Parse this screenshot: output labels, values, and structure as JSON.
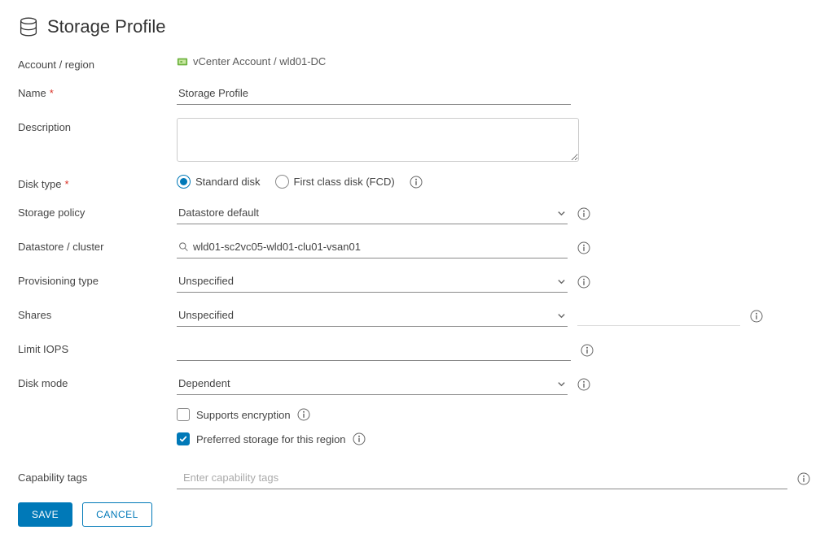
{
  "page": {
    "title": "Storage Profile"
  },
  "account": {
    "label": "Account / region",
    "value": "vCenter Account / wld01-DC"
  },
  "name": {
    "label": "Name",
    "required": true,
    "value": "Storage Profile"
  },
  "description": {
    "label": "Description",
    "value": ""
  },
  "diskType": {
    "label": "Disk type",
    "required": true,
    "options": {
      "standard": "Standard disk",
      "fcd": "First class disk (FCD)"
    },
    "selected": "standard"
  },
  "storagePolicy": {
    "label": "Storage policy",
    "value": "Datastore default"
  },
  "datastore": {
    "label": "Datastore / cluster",
    "value": "wld01-sc2vc05-wld01-clu01-vsan01"
  },
  "provisioningType": {
    "label": "Provisioning type",
    "value": "Unspecified"
  },
  "shares": {
    "label": "Shares",
    "value": "Unspecified",
    "extra": ""
  },
  "limitIops": {
    "label": "Limit IOPS",
    "value": ""
  },
  "diskMode": {
    "label": "Disk mode",
    "value": "Dependent"
  },
  "checkboxes": {
    "encryption": {
      "label": "Supports encryption",
      "checked": false
    },
    "preferred": {
      "label": "Preferred storage for this region",
      "checked": true
    }
  },
  "tags": {
    "label": "Capability tags",
    "placeholder": "Enter capability tags"
  },
  "buttons": {
    "save": "Save",
    "cancel": "Cancel"
  }
}
